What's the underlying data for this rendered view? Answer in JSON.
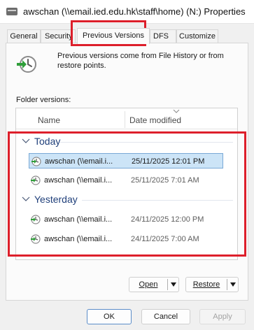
{
  "window": {
    "title": "awschan (\\\\email.ied.edu.hk\\staff\\home) (N:) Properties"
  },
  "tabs": [
    {
      "label": "General",
      "active": false
    },
    {
      "label": "Security",
      "active": false
    },
    {
      "label": "Previous Versions",
      "active": true
    },
    {
      "label": "DFS",
      "active": false
    },
    {
      "label": "Customize",
      "active": false
    }
  ],
  "intro": {
    "icon": "file-history-icon",
    "text": "Previous versions come from File History or from restore points."
  },
  "folder_versions": {
    "label": "Folder versions:",
    "columns": [
      "Name",
      "Date modified"
    ],
    "groups": [
      {
        "label": "Today",
        "rows": [
          {
            "name": "awschan (\\\\email.i...",
            "date": "25/11/2025 12:01 PM",
            "selected": true
          },
          {
            "name": "awschan (\\\\email.i...",
            "date": "25/11/2025 7:01 AM",
            "selected": false
          }
        ]
      },
      {
        "label": "Yesterday",
        "rows": [
          {
            "name": "awschan (\\\\email.i...",
            "date": "24/11/2025 12:00 PM",
            "selected": false
          },
          {
            "name": "awschan (\\\\email.i...",
            "date": "24/11/2025 7:00 AM",
            "selected": false
          }
        ]
      }
    ]
  },
  "actions": {
    "open": "Open",
    "restore": "Restore"
  },
  "footer": {
    "ok": "OK",
    "cancel": "Cancel",
    "apply": "Apply"
  },
  "colors": {
    "highlight": "#dd1f2b",
    "selection": "#cce4f7",
    "group_header": "#1f3f7a"
  }
}
